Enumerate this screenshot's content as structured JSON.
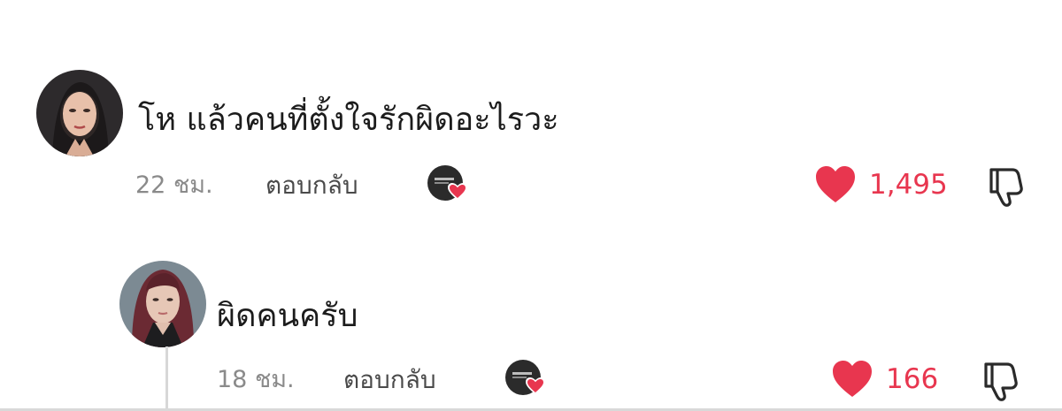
{
  "comments": [
    {
      "text": "โห แล้วคนที่ตั้งใจรักผิดอะไรวะ",
      "time": "22 ชม.",
      "reply_label": "ตอบกลับ",
      "likes": "1,495"
    },
    {
      "text": "ผิดคนครับ",
      "time": "18 ชม.",
      "reply_label": "ตอบกลับ",
      "likes": "166"
    }
  ],
  "colors": {
    "like_red": "#e8364f",
    "text": "#1c1c1c",
    "muted": "#8a8a8a"
  },
  "icons": [
    "avatar",
    "creator-liked-heart-icon",
    "heart-icon",
    "dislike-icon"
  ]
}
